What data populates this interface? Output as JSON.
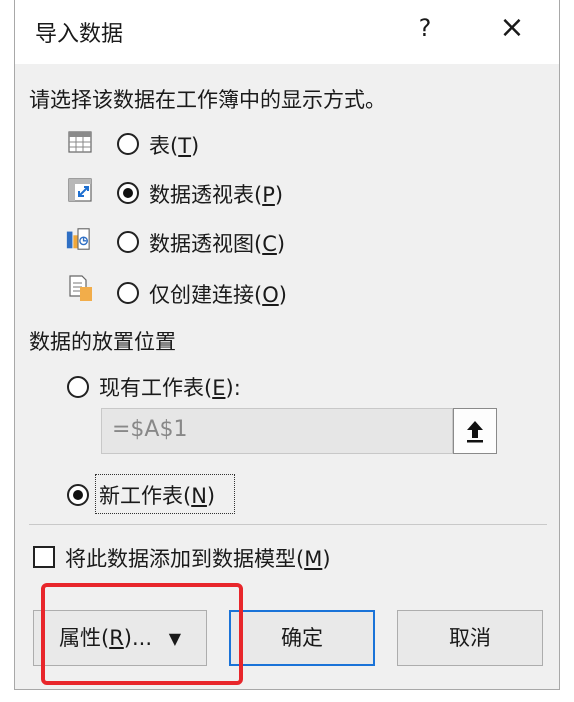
{
  "dialog": {
    "title": "导入数据",
    "help_label": "?",
    "close_label": "×"
  },
  "view_section": {
    "prompt": "请选择该数据在工作簿中的显示方式。",
    "options": [
      {
        "label": "表",
        "key": "T",
        "checked": false,
        "icon": "table-icon"
      },
      {
        "label": "数据透视表",
        "key": "P",
        "checked": true,
        "icon": "pivot-table-icon"
      },
      {
        "label": "数据透视图",
        "key": "C",
        "checked": false,
        "icon": "pivot-chart-icon"
      },
      {
        "label": "仅创建连接",
        "key": "O",
        "checked": false,
        "icon": "connection-only-icon"
      }
    ]
  },
  "location_section": {
    "heading": "数据的放置位置",
    "existing_label": "现有工作表",
    "existing_key": "E",
    "existing_suffix": ":",
    "cell_value": "=$A$1",
    "new_sheet_label": "新工作表",
    "new_sheet_key": "N",
    "selected": "new_sheet"
  },
  "data_model": {
    "label": "将此数据添加到数据模型",
    "key": "M",
    "checked": false
  },
  "buttons": {
    "properties_label": "属性",
    "properties_key": "R",
    "properties_suffix": "...",
    "ok_label": "确定",
    "cancel_label": "取消"
  },
  "colors": {
    "highlight": "#e8262b",
    "focus_border": "#1a73d8",
    "dialog_bg": "#f0f0f0"
  }
}
